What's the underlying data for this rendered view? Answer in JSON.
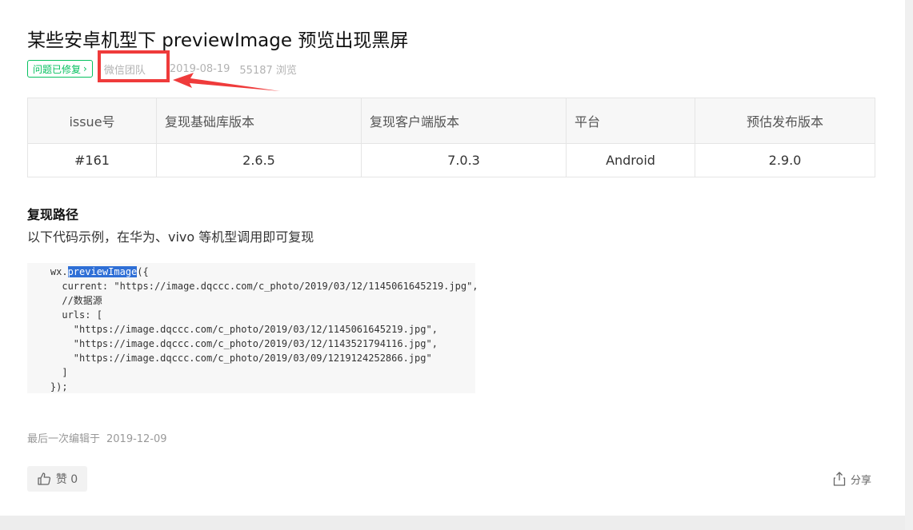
{
  "post": {
    "title": "某些安卓机型下 previewImage 预览出现黑屏",
    "status_badge": "问题已修复",
    "author": "微信团队",
    "date": "2019-08-19",
    "views": "55187 浏览"
  },
  "table": {
    "headers": [
      "issue号",
      "复现基础库版本",
      "复现客户端版本",
      "平台",
      "预估发布版本"
    ],
    "row": [
      "#161",
      "2.6.5",
      "7.0.3",
      "Android",
      "2.9.0"
    ]
  },
  "section": {
    "title": "复现路径",
    "desc": "以下代码示例，在华为、vivo 等机型调用即可复现"
  },
  "code": {
    "line0_prefix": "    wx.",
    "line0_highlight": "previewImage",
    "line0_suffix": "({",
    "line1": "      current: \"https://image.dqccc.com/c_photo/2019/03/12/1145061645219.jpg\",",
    "line2": "      //数据源",
    "line3": "      urls: [",
    "line4": "        \"https://image.dqccc.com/c_photo/2019/03/12/1145061645219.jpg\",",
    "line5": "        \"https://image.dqccc.com/c_photo/2019/03/12/1143521794116.jpg\",",
    "line6": "        \"https://image.dqccc.com/c_photo/2019/03/09/1219124252866.jpg\"",
    "line7": "      ]",
    "line8": "    });"
  },
  "footer": {
    "edited_label": "最后一次编辑于",
    "edited_date": "2019-12-09",
    "like_label": "赞 0",
    "share_label": "分享"
  },
  "icons": {
    "like": "thumbs-up-icon",
    "share": "share-icon"
  },
  "colors": {
    "accent_green": "#07c160",
    "annotation_red": "#ef3b3b",
    "highlight_blue": "#2f6fd6"
  }
}
